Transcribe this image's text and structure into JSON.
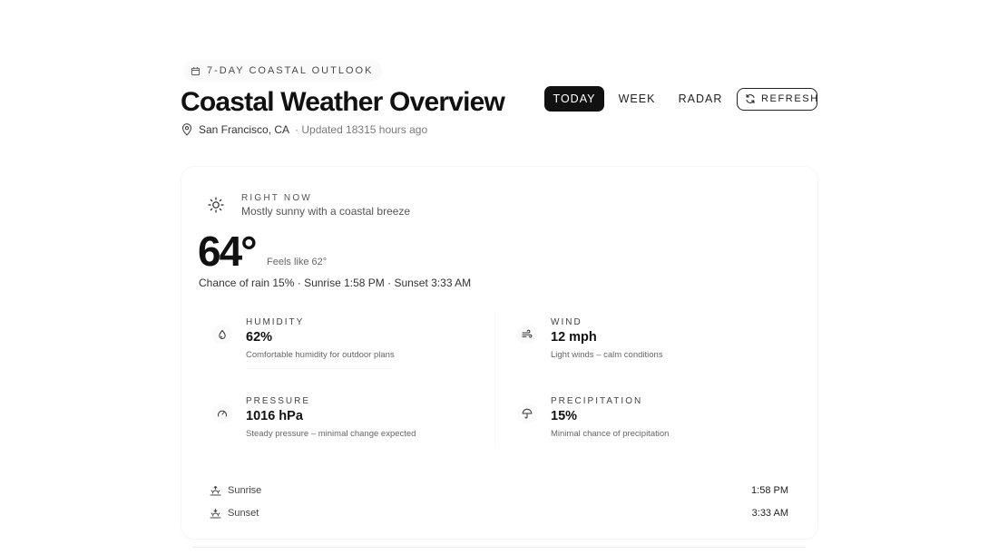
{
  "header": {
    "eyebrow": "7-DAY COASTAL OUTLOOK",
    "title": "Coastal Weather Overview",
    "location": "San Francisco, CA",
    "updated": "· Updated 18315 hours ago"
  },
  "tabs": {
    "today": "TODAY",
    "week": "WEEK",
    "radar": "RADAR",
    "refresh": "REFRESH",
    "active": "today"
  },
  "current": {
    "label": "RIGHT NOW",
    "description": "Mostly sunny with a coastal breeze",
    "temperature": "64°",
    "feels_like": "Feels like 62°",
    "summary": "Chance of rain 15% · Sunrise 1:58 PM · Sunset 3:33 AM"
  },
  "metrics": {
    "humidity": {
      "label": "HUMIDITY",
      "value": "62%",
      "note": "Comfortable humidity for outdoor plans",
      "icon": "droplet-icon"
    },
    "wind": {
      "label": "WIND",
      "value": "12 mph",
      "note": "Light winds – calm conditions",
      "icon": "wind-icon"
    },
    "pressure": {
      "label": "PRESSURE",
      "value": "1016 hPa",
      "note": "Steady pressure – minimal change expected",
      "icon": "gauge-icon"
    },
    "precipitation": {
      "label": "PRECIPITATION",
      "value": "15%",
      "note": "Minimal chance of precipitation",
      "icon": "umbrella-icon"
    }
  },
  "sun_times": {
    "sunrise_label": "Sunrise",
    "sunrise_time": "1:58 PM",
    "sunset_label": "Sunset",
    "sunset_time": "3:33 AM"
  },
  "colors": {
    "accent": "#111111",
    "text": "#111111",
    "muted": "#666666",
    "background": "#ffffff"
  }
}
